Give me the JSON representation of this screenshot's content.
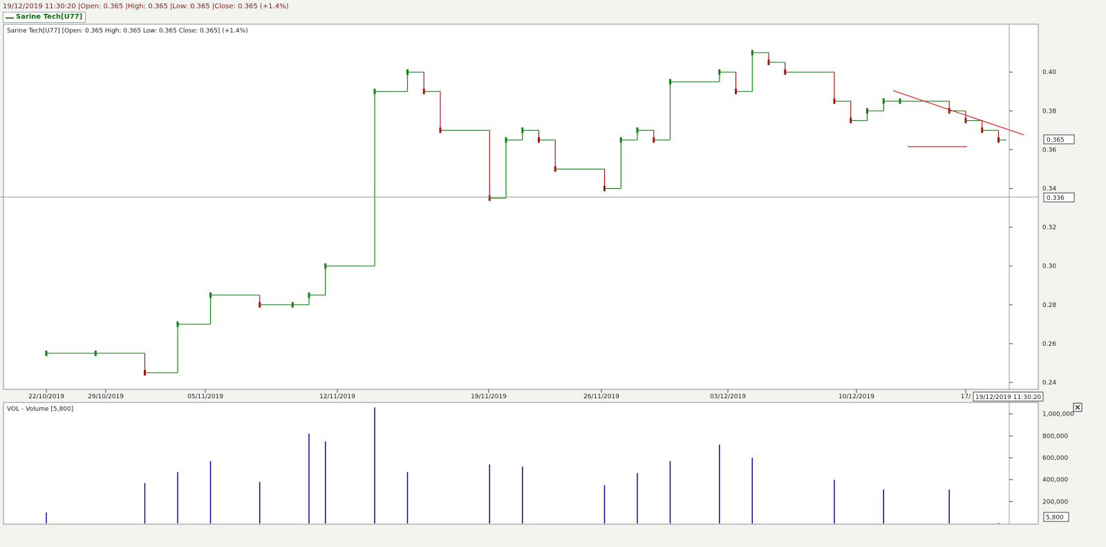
{
  "header": {
    "info_line": "19/12/2019 11:30:20 |Open: 0.365 |High: 0.365 |Low: 0.365 |Close: 0.365 (+1.4%)",
    "legend_label": "Sarine Tech[U77]"
  },
  "colors": {
    "background": "#ffffff",
    "panel_border": "#8c8c8c",
    "up": "#0a8a0a",
    "down": "#b01010",
    "volume": "#0a0aa0",
    "trendline": "#d03030",
    "crosshair": "#9a9a9a"
  },
  "price_panel": {
    "info_label": "Sarine Tech[U77] [Open: 0.365  High: 0.365  Low: 0.365  Close: 0.365] (+1.4%)",
    "last_price_box": "0.365",
    "crosshair_price_box": "0.336",
    "crosshair_time_box": "19/12/2019 11:30:20"
  },
  "volume_panel": {
    "info_label": "VOL - Volume [5,800]",
    "last_volume_box": "5,800",
    "close_icon": "close-x-icon"
  },
  "chart_data": [
    {
      "type": "line",
      "title": "Sarine Tech[U77]",
      "ylabel": "",
      "xlabel": "",
      "ylim": [
        0.236,
        0.423
      ],
      "y_ticks": [
        0.24,
        0.26,
        0.28,
        0.3,
        0.32,
        0.34,
        0.36,
        0.38,
        0.4
      ],
      "y_tick_labels": [
        "0.24",
        "0.26",
        "0.28",
        "0.30",
        "0.32",
        "0.34",
        "0.36",
        "0.38",
        "0.40"
      ],
      "x_tick_labels": [
        "22/10/2019",
        "29/10/2019",
        "05/11/2019",
        "12/11/2019",
        "19/11/2019",
        "26/11/2019",
        "03/12/2019",
        "10/12/2019",
        "17/"
      ],
      "grid": false,
      "series": [
        {
          "name": "Sarine Tech[U77]",
          "x": [
            "22/10/2019",
            "25/10/2019",
            "28/10/2019",
            "30/10/2019",
            "01/11/2019",
            "04/11/2019",
            "06/11/2019",
            "07/11/2019",
            "08/11/2019",
            "11/11/2019",
            "13/11/2019",
            "14/11/2019",
            "15/11/2019",
            "18/11/2019",
            "19/11/2019",
            "20/11/2019",
            "21/11/2019",
            "22/11/2019",
            "25/11/2019",
            "26/11/2019",
            "27/11/2019",
            "28/11/2019",
            "29/11/2019",
            "02/12/2019",
            "03/12/2019",
            "04/12/2019",
            "05/12/2019",
            "06/12/2019",
            "09/12/2019",
            "10/12/2019",
            "11/12/2019",
            "12/12/2019",
            "13/12/2019",
            "16/12/2019",
            "17/12/2019",
            "18/12/2019",
            "19/12/2019"
          ],
          "values": [
            0.255,
            0.255,
            0.245,
            0.27,
            0.285,
            0.28,
            0.28,
            0.285,
            0.3,
            0.39,
            0.4,
            0.39,
            0.37,
            0.335,
            0.365,
            0.37,
            0.365,
            0.35,
            0.34,
            0.365,
            0.37,
            0.365,
            0.395,
            0.4,
            0.39,
            0.41,
            0.405,
            0.4,
            0.385,
            0.375,
            0.38,
            0.385,
            0.385,
            0.38,
            0.375,
            0.37,
            0.365
          ]
        }
      ]
    },
    {
      "type": "bar",
      "title": "VOL - Volume",
      "ylim": [
        0,
        1080000
      ],
      "y_ticks": [
        200000,
        400000,
        600000,
        800000,
        1000000
      ],
      "y_tick_labels": [
        "200,000",
        "400,000",
        "600,000",
        "800,000",
        "1,000,000"
      ],
      "series": [
        {
          "name": "Volume",
          "x": [
            "22/10/2019",
            "28/10/2019",
            "30/10/2019",
            "01/11/2019",
            "04/11/2019",
            "07/11/2019",
            "08/11/2019",
            "11/11/2019",
            "13/11/2019",
            "18/11/2019",
            "20/11/2019",
            "25/11/2019",
            "27/11/2019",
            "29/11/2019",
            "02/12/2019",
            "04/12/2019",
            "09/12/2019",
            "12/12/2019",
            "16/12/2019",
            "19/12/2019"
          ],
          "values": [
            100000,
            370000,
            470000,
            570000,
            380000,
            820000,
            750000,
            1060000,
            470000,
            540000,
            520000,
            350000,
            460000,
            570000,
            720000,
            600000,
            400000,
            310000,
            310000,
            5800
          ]
        }
      ]
    }
  ]
}
